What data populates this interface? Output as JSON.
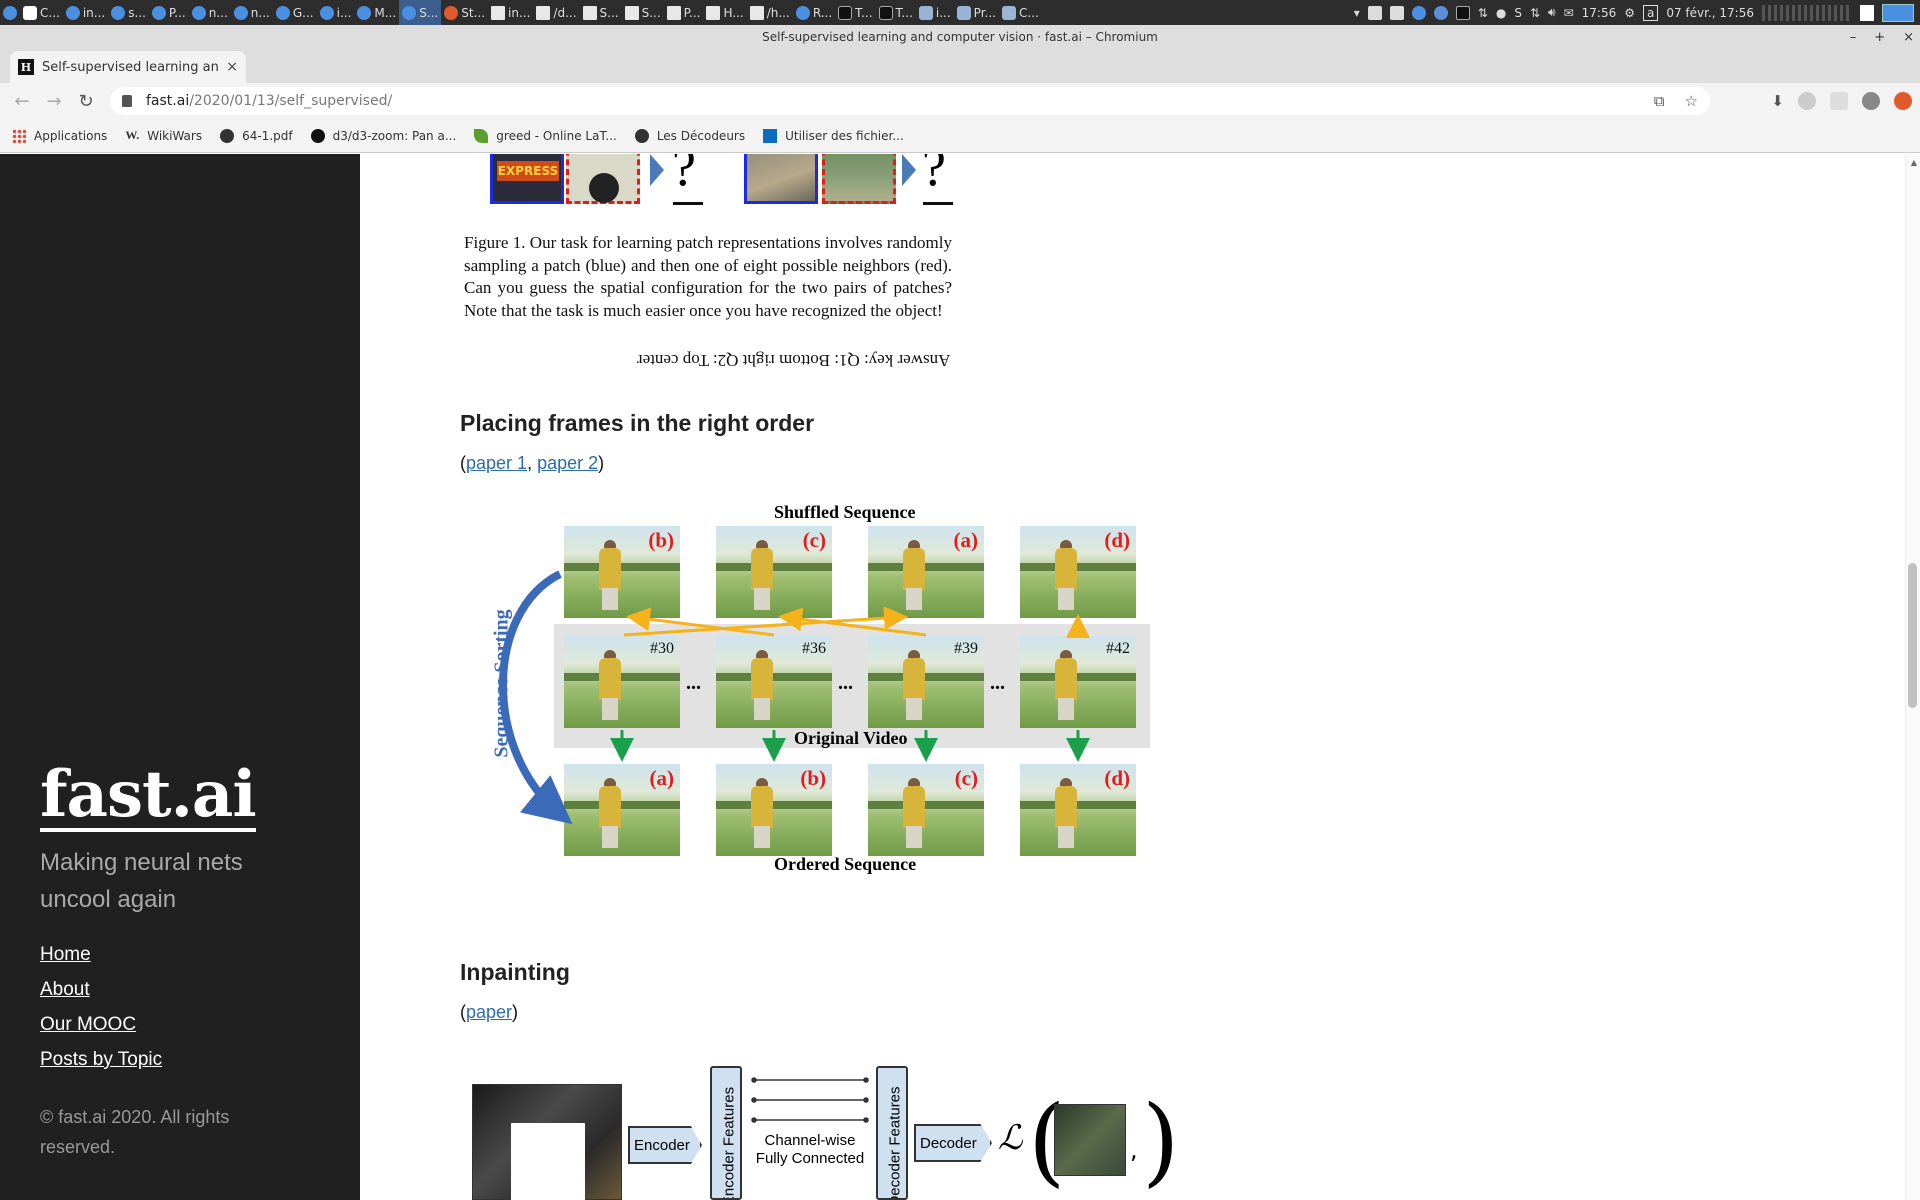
{
  "taskbar": {
    "items": [
      {
        "label": "C..."
      },
      {
        "label": "in..."
      },
      {
        "label": "s..."
      },
      {
        "label": "P..."
      },
      {
        "label": "n..."
      },
      {
        "label": "n..."
      },
      {
        "label": "G..."
      },
      {
        "label": "i..."
      },
      {
        "label": "M..."
      },
      {
        "label": "S...",
        "active": true
      },
      {
        "label": "St..."
      },
      {
        "label": "in..."
      },
      {
        "label": "/d..."
      },
      {
        "label": "S..."
      },
      {
        "label": "S..."
      },
      {
        "label": "P..."
      },
      {
        "label": "H..."
      },
      {
        "label": "/h..."
      },
      {
        "label": "R..."
      },
      {
        "label": "T..."
      },
      {
        "label": "T..."
      },
      {
        "label": "i..."
      },
      {
        "label": "Pr..."
      },
      {
        "label": "C..."
      }
    ],
    "clock": "17:56",
    "date": "07 févr., 17:56",
    "keyboard_indicator": "a"
  },
  "window": {
    "title": "Self-supervised learning and computer vision · fast.ai – Chromium",
    "controls": [
      "–",
      "+",
      "×"
    ]
  },
  "tab": {
    "favicon": "H",
    "title": "Self-supervised learning and co",
    "close": "×",
    "new_tab": "+"
  },
  "toolbar": {
    "back": "←",
    "forward": "→",
    "reload": "↻",
    "url_host": "fast.ai",
    "url_path": "/2020/01/13/self_supervised/"
  },
  "bookmarks": [
    {
      "label": "Applications",
      "icon": "apps-grid-icon"
    },
    {
      "label": "WikiWars",
      "icon": "wikipedia-icon"
    },
    {
      "label": "64-1.pdf",
      "icon": "globe-icon"
    },
    {
      "label": "d3/d3-zoom: Pan a...",
      "icon": "github-icon"
    },
    {
      "label": "greed - Online LaT...",
      "icon": "leaf-icon"
    },
    {
      "label": "Les Décodeurs",
      "icon": "globe-icon"
    },
    {
      "label": "Utiliser des fichier...",
      "icon": "sharepoint-icon"
    }
  ],
  "sidebar": {
    "logo": "fast.ai",
    "tagline": "Making neural nets uncool again",
    "nav": [
      "Home",
      "About",
      "Our MOOC",
      "Posts by Topic"
    ],
    "copyright": "© fast.ai 2020. All rights reserved."
  },
  "figure1": {
    "question_marks": [
      "?",
      "?"
    ],
    "express_text": "EXPRESS",
    "caption": "Figure 1. Our task for learning patch representations involves randomly sampling a patch (blue) and then one of eight possible neighbors (red). Can you guess the spatial configuration for the two pairs of patches? Note that the task is much easier once you have recognized the object!",
    "answer_key": "Answer key: Q1: Bottom right Q2: Top center"
  },
  "section_placing": {
    "heading": "Placing frames in the right order",
    "paren_open": "(",
    "paper1": "paper 1",
    "comma": ", ",
    "paper2": "paper 2",
    "paren_close": ")"
  },
  "figure2": {
    "shuffled_title": "Shuffled Sequence",
    "original_title": "Original Video",
    "ordered_title": "Ordered Sequence",
    "side_label": "Sequence Sorting",
    "shuffled_labels": [
      "(b)",
      "(c)",
      "(a)",
      "(d)"
    ],
    "original_numbers": [
      "#30",
      "#36",
      "#39",
      "#42"
    ],
    "ellipses": [
      "...",
      "...",
      "..."
    ],
    "ordered_labels": [
      "(a)",
      "(b)",
      "(c)",
      "(d)"
    ]
  },
  "section_inpainting": {
    "heading": "Inpainting",
    "paren_open": "(",
    "paper": "paper",
    "paren_close": ")"
  },
  "figure3": {
    "encoder": "Encoder",
    "encoder_features": "Encoder Features",
    "channel_wise": "Channel-wise Fully Connected",
    "decoder_features": "Decoder Features",
    "decoder": "Decoder",
    "loss_symbol": "ℒ"
  }
}
